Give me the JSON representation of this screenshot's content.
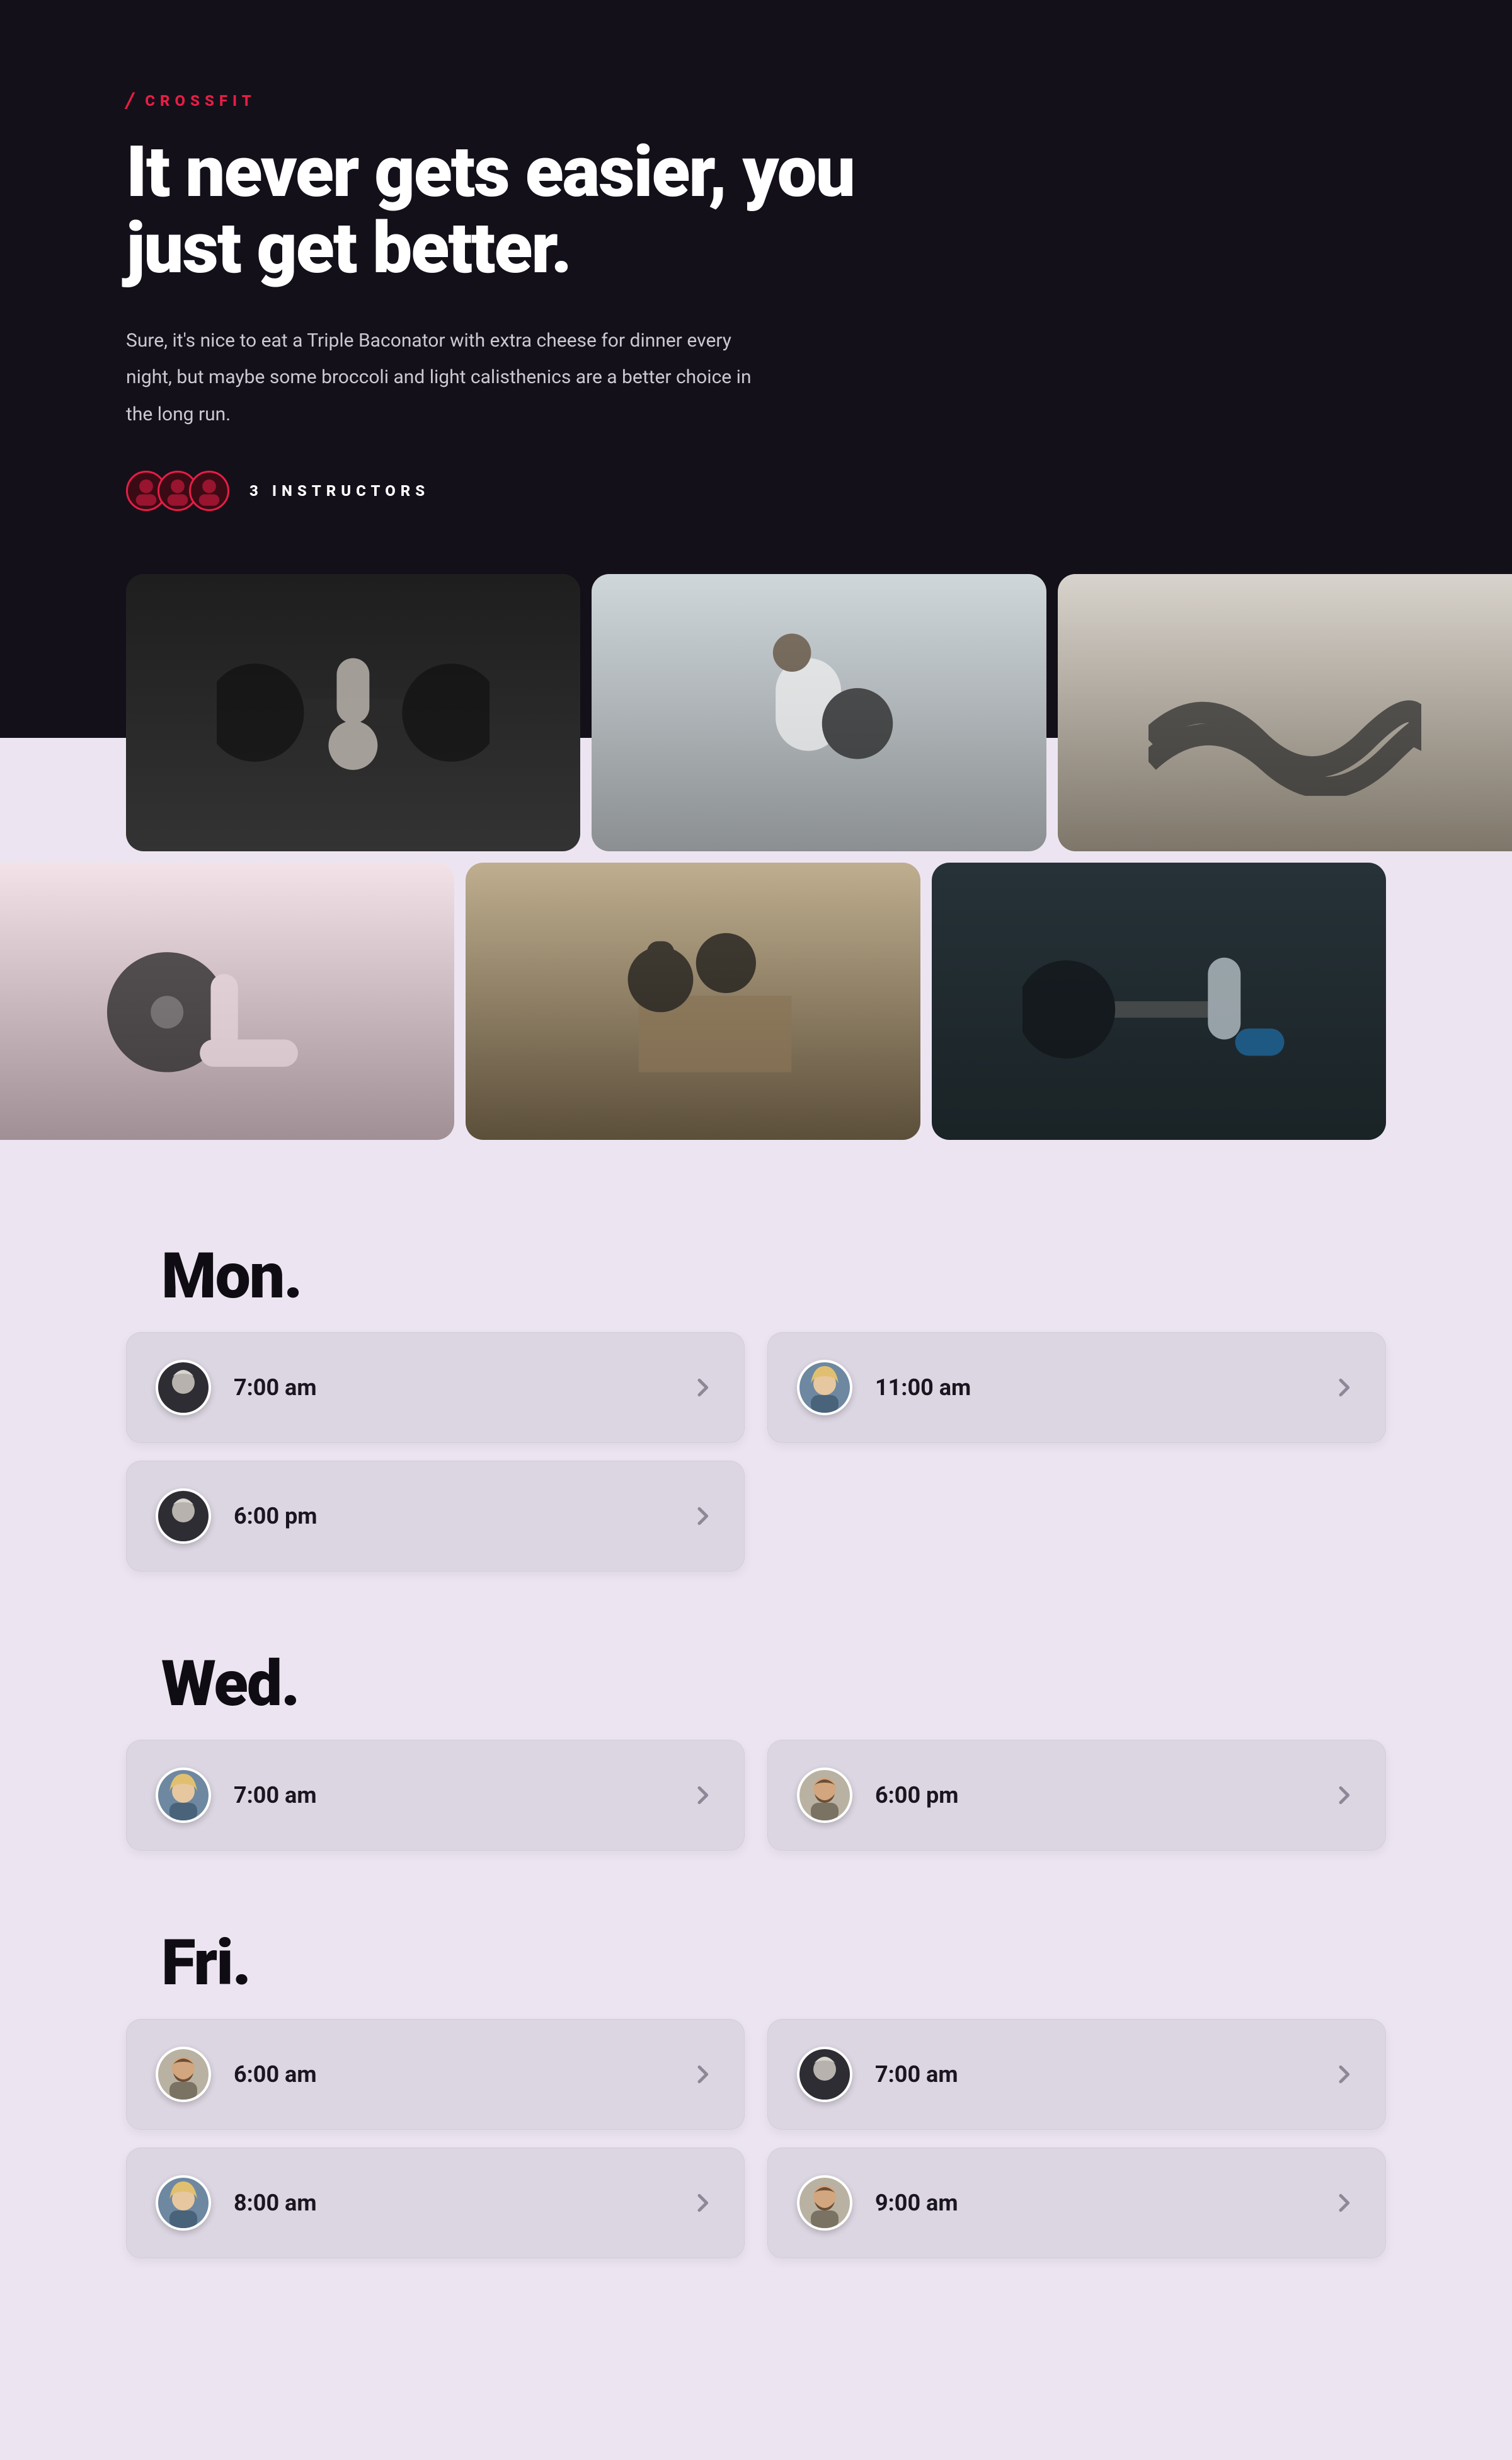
{
  "hero": {
    "eyebrow_slash": "/",
    "eyebrow": "CROSSFIT",
    "title": "It never gets easier, you just get better.",
    "description": "Sure, it's nice to eat a Triple Baconator with extra cheese for dinner every night, but maybe some broccoli and light calisthenics are a better choice in the long run.",
    "instructors_label": "3 INSTRUCTORS"
  },
  "gallery": {
    "row1": [
      {
        "name": "gym-photo-barbell-back"
      },
      {
        "name": "gym-photo-medicine-ball"
      },
      {
        "name": "gym-photo-battle-ropes"
      }
    ],
    "row2": [
      {
        "name": "gym-photo-weight-plates"
      },
      {
        "name": "gym-photo-kettlebell-box"
      },
      {
        "name": "gym-photo-deadlift"
      }
    ]
  },
  "schedule": [
    {
      "day": "Mon.",
      "slots": [
        {
          "time": "7:00 am",
          "instructor": "gray"
        },
        {
          "time": "11:00 am",
          "instructor": "blonde"
        },
        {
          "time": "6:00 pm",
          "instructor": "gray"
        }
      ]
    },
    {
      "day": "Wed.",
      "slots": [
        {
          "time": "7:00 am",
          "instructor": "blonde"
        },
        {
          "time": "6:00 pm",
          "instructor": "beard"
        }
      ]
    },
    {
      "day": "Fri.",
      "slots": [
        {
          "time": "6:00 am",
          "instructor": "beard"
        },
        {
          "time": "7:00 am",
          "instructor": "gray"
        },
        {
          "time": "8:00 am",
          "instructor": "blonde"
        },
        {
          "time": "9:00 am",
          "instructor": "beard"
        }
      ]
    }
  ]
}
